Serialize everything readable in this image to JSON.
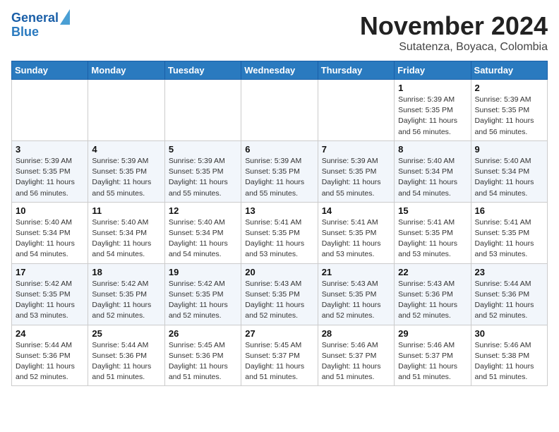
{
  "header": {
    "logo_line1": "General",
    "logo_line2": "Blue",
    "month_year": "November 2024",
    "location": "Sutatenza, Boyaca, Colombia"
  },
  "weekdays": [
    "Sunday",
    "Monday",
    "Tuesday",
    "Wednesday",
    "Thursday",
    "Friday",
    "Saturday"
  ],
  "weeks": [
    [
      {
        "num": "",
        "info": ""
      },
      {
        "num": "",
        "info": ""
      },
      {
        "num": "",
        "info": ""
      },
      {
        "num": "",
        "info": ""
      },
      {
        "num": "",
        "info": ""
      },
      {
        "num": "1",
        "info": "Sunrise: 5:39 AM\nSunset: 5:35 PM\nDaylight: 11 hours\nand 56 minutes."
      },
      {
        "num": "2",
        "info": "Sunrise: 5:39 AM\nSunset: 5:35 PM\nDaylight: 11 hours\nand 56 minutes."
      }
    ],
    [
      {
        "num": "3",
        "info": "Sunrise: 5:39 AM\nSunset: 5:35 PM\nDaylight: 11 hours\nand 56 minutes."
      },
      {
        "num": "4",
        "info": "Sunrise: 5:39 AM\nSunset: 5:35 PM\nDaylight: 11 hours\nand 55 minutes."
      },
      {
        "num": "5",
        "info": "Sunrise: 5:39 AM\nSunset: 5:35 PM\nDaylight: 11 hours\nand 55 minutes."
      },
      {
        "num": "6",
        "info": "Sunrise: 5:39 AM\nSunset: 5:35 PM\nDaylight: 11 hours\nand 55 minutes."
      },
      {
        "num": "7",
        "info": "Sunrise: 5:39 AM\nSunset: 5:35 PM\nDaylight: 11 hours\nand 55 minutes."
      },
      {
        "num": "8",
        "info": "Sunrise: 5:40 AM\nSunset: 5:34 PM\nDaylight: 11 hours\nand 54 minutes."
      },
      {
        "num": "9",
        "info": "Sunrise: 5:40 AM\nSunset: 5:34 PM\nDaylight: 11 hours\nand 54 minutes."
      }
    ],
    [
      {
        "num": "10",
        "info": "Sunrise: 5:40 AM\nSunset: 5:34 PM\nDaylight: 11 hours\nand 54 minutes."
      },
      {
        "num": "11",
        "info": "Sunrise: 5:40 AM\nSunset: 5:34 PM\nDaylight: 11 hours\nand 54 minutes."
      },
      {
        "num": "12",
        "info": "Sunrise: 5:40 AM\nSunset: 5:34 PM\nDaylight: 11 hours\nand 54 minutes."
      },
      {
        "num": "13",
        "info": "Sunrise: 5:41 AM\nSunset: 5:35 PM\nDaylight: 11 hours\nand 53 minutes."
      },
      {
        "num": "14",
        "info": "Sunrise: 5:41 AM\nSunset: 5:35 PM\nDaylight: 11 hours\nand 53 minutes."
      },
      {
        "num": "15",
        "info": "Sunrise: 5:41 AM\nSunset: 5:35 PM\nDaylight: 11 hours\nand 53 minutes."
      },
      {
        "num": "16",
        "info": "Sunrise: 5:41 AM\nSunset: 5:35 PM\nDaylight: 11 hours\nand 53 minutes."
      }
    ],
    [
      {
        "num": "17",
        "info": "Sunrise: 5:42 AM\nSunset: 5:35 PM\nDaylight: 11 hours\nand 53 minutes."
      },
      {
        "num": "18",
        "info": "Sunrise: 5:42 AM\nSunset: 5:35 PM\nDaylight: 11 hours\nand 52 minutes."
      },
      {
        "num": "19",
        "info": "Sunrise: 5:42 AM\nSunset: 5:35 PM\nDaylight: 11 hours\nand 52 minutes."
      },
      {
        "num": "20",
        "info": "Sunrise: 5:43 AM\nSunset: 5:35 PM\nDaylight: 11 hours\nand 52 minutes."
      },
      {
        "num": "21",
        "info": "Sunrise: 5:43 AM\nSunset: 5:35 PM\nDaylight: 11 hours\nand 52 minutes."
      },
      {
        "num": "22",
        "info": "Sunrise: 5:43 AM\nSunset: 5:36 PM\nDaylight: 11 hours\nand 52 minutes."
      },
      {
        "num": "23",
        "info": "Sunrise: 5:44 AM\nSunset: 5:36 PM\nDaylight: 11 hours\nand 52 minutes."
      }
    ],
    [
      {
        "num": "24",
        "info": "Sunrise: 5:44 AM\nSunset: 5:36 PM\nDaylight: 11 hours\nand 52 minutes."
      },
      {
        "num": "25",
        "info": "Sunrise: 5:44 AM\nSunset: 5:36 PM\nDaylight: 11 hours\nand 51 minutes."
      },
      {
        "num": "26",
        "info": "Sunrise: 5:45 AM\nSunset: 5:36 PM\nDaylight: 11 hours\nand 51 minutes."
      },
      {
        "num": "27",
        "info": "Sunrise: 5:45 AM\nSunset: 5:37 PM\nDaylight: 11 hours\nand 51 minutes."
      },
      {
        "num": "28",
        "info": "Sunrise: 5:46 AM\nSunset: 5:37 PM\nDaylight: 11 hours\nand 51 minutes."
      },
      {
        "num": "29",
        "info": "Sunrise: 5:46 AM\nSunset: 5:37 PM\nDaylight: 11 hours\nand 51 minutes."
      },
      {
        "num": "30",
        "info": "Sunrise: 5:46 AM\nSunset: 5:38 PM\nDaylight: 11 hours\nand 51 minutes."
      }
    ]
  ]
}
